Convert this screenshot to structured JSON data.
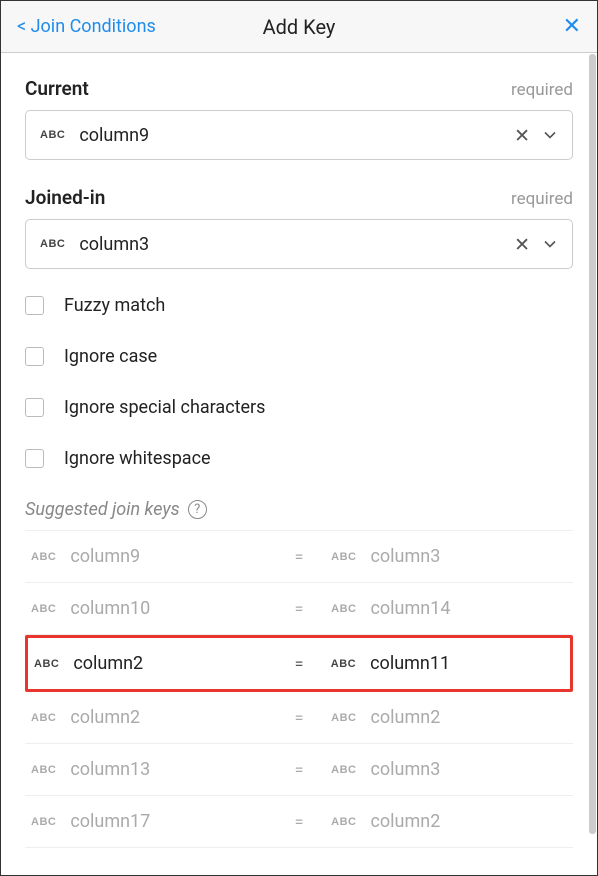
{
  "header": {
    "back_label": "< Join Conditions",
    "title": "Add Key"
  },
  "fields": {
    "current": {
      "label": "Current",
      "required": "required",
      "value": "column9"
    },
    "joined": {
      "label": "Joined-in",
      "required": "required",
      "value": "column3"
    }
  },
  "options": {
    "fuzzy": "Fuzzy match",
    "ignore_case": "Ignore case",
    "ignore_special": "Ignore special characters",
    "ignore_ws": "Ignore whitespace"
  },
  "suggested": {
    "label": "Suggested join keys",
    "rows": [
      {
        "left": "column9",
        "right": "column3",
        "selected": false
      },
      {
        "left": "column10",
        "right": "column14",
        "selected": false
      },
      {
        "left": "column2",
        "right": "column11",
        "selected": true
      },
      {
        "left": "column2",
        "right": "column2",
        "selected": false
      },
      {
        "left": "column13",
        "right": "column3",
        "selected": false
      },
      {
        "left": "column17",
        "right": "column2",
        "selected": false
      }
    ]
  },
  "eq": "="
}
